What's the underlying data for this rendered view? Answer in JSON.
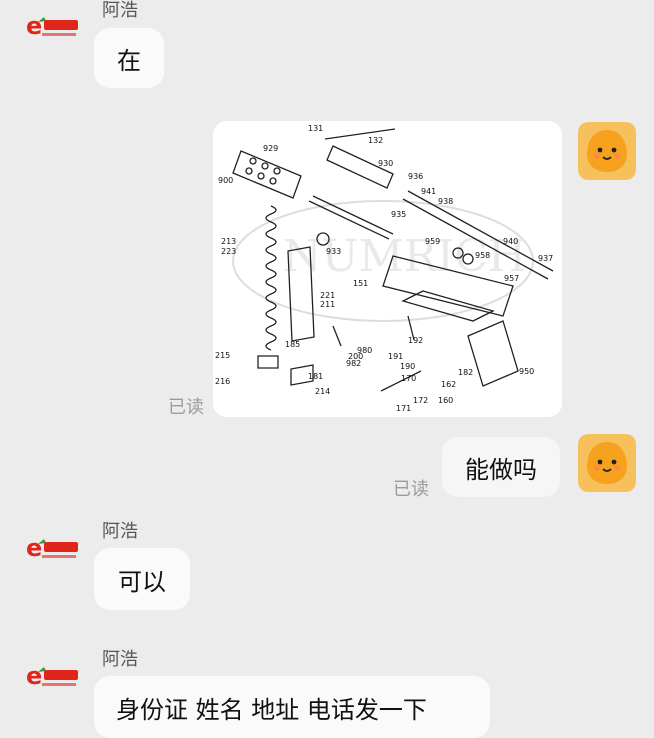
{
  "chat": {
    "messages": [
      {
        "sender": "阿浩",
        "text": "在"
      },
      {
        "type": "image",
        "labels": [
          "131",
          "132",
          "929",
          "930",
          "936",
          "941",
          "938",
          "900",
          "935",
          "940",
          "937",
          "213",
          "223",
          "933",
          "959",
          "958",
          "957",
          "151",
          "221",
          "211",
          "185",
          "980",
          "982",
          "191",
          "190",
          "192",
          "182",
          "950",
          "215",
          "216",
          "181",
          "200",
          "214",
          "170",
          "162",
          "172",
          "160",
          "171"
        ]
      },
      {
        "text": "能做吗"
      },
      {
        "sender": "阿浩",
        "text": "可以"
      },
      {
        "sender": "阿浩",
        "text": "身份证 姓名 地址 电话发一下"
      }
    ],
    "read_label": "已读"
  },
  "icons": {
    "shop_avatar": "shop-logo-avatar",
    "my_avatar": "orange-mascot-avatar"
  },
  "colors": {
    "background": "#ececec",
    "bubble": "#fafafa",
    "read_label": "#9b9b9b",
    "logo_red": "#e0261b",
    "mascot_orange": "#f7a21e"
  }
}
